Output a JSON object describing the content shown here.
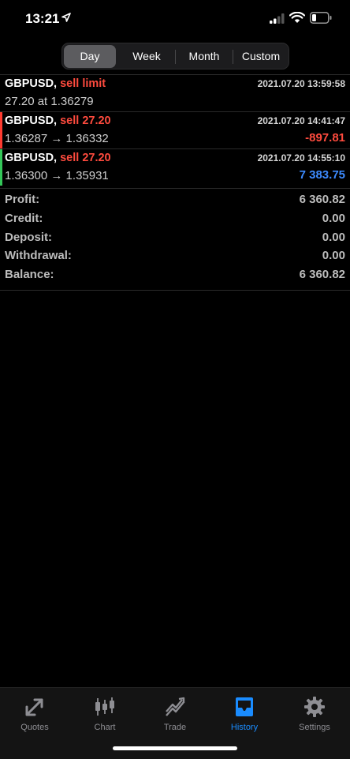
{
  "status_bar": {
    "time": "13:21"
  },
  "filters": {
    "tabs": [
      {
        "label": "Day",
        "active": true
      },
      {
        "label": "Week",
        "active": false
      },
      {
        "label": "Month",
        "active": false
      },
      {
        "label": "Custom",
        "active": false
      }
    ]
  },
  "orders": [
    {
      "symbol": "GBPUSD,",
      "type": "sell limit",
      "time": "2021.07.20 13:59:58",
      "detail": "27.20 at 1.36279",
      "profit": "",
      "accent": ""
    },
    {
      "symbol": "GBPUSD,",
      "type": "sell 27.20",
      "time": "2021.07.20 14:41:47",
      "detail": "1.36287 → 1.36332",
      "profit": "-897.81",
      "accent": "#ff3b30",
      "profit_color": "#ff4b3e"
    },
    {
      "symbol": "GBPUSD,",
      "type": "sell 27.20",
      "time": "2021.07.20 14:55:10",
      "detail": "1.36300 → 1.35931",
      "profit": "7 383.75",
      "accent": "#34c759",
      "profit_color": "#3d8bff"
    }
  ],
  "summary": [
    {
      "label": "Profit:",
      "value": "6 360.82"
    },
    {
      "label": "Credit:",
      "value": "0.00"
    },
    {
      "label": "Deposit:",
      "value": "0.00"
    },
    {
      "label": "Withdrawal:",
      "value": "0.00"
    },
    {
      "label": "Balance:",
      "value": "6 360.82"
    }
  ],
  "tabbar": [
    {
      "label": "Quotes",
      "icon": "quotes-icon"
    },
    {
      "label": "Chart",
      "icon": "candlestick-icon"
    },
    {
      "label": "Trade",
      "icon": "trade-icon"
    },
    {
      "label": "History",
      "icon": "inbox-icon",
      "active": true
    },
    {
      "label": "Settings",
      "icon": "gear-icon"
    }
  ],
  "colors": {
    "accent": "#1a8cff",
    "loss": "#ff4b3e",
    "gain": "#3d8bff"
  }
}
